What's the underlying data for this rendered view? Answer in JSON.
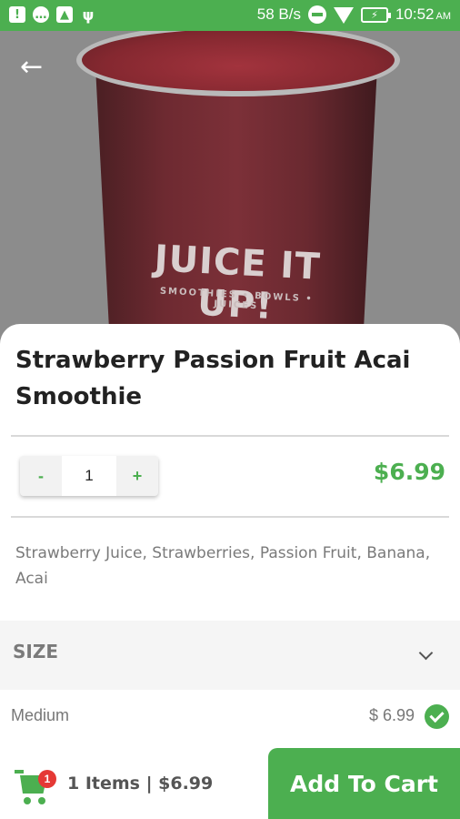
{
  "status_bar": {
    "speed": "58 B/s",
    "time": "10:52",
    "ampm": "AM",
    "icons": [
      "alert-icon",
      "message-icon",
      "image-icon",
      "usb-icon",
      "dnd-icon",
      "wifi-icon",
      "battery-charging-icon"
    ]
  },
  "hero": {
    "logo": "JUICE IT UP!",
    "logo_sub": "SMOOTHIES • BOWLS • JUICES",
    "back_icon": "arrow-left-icon"
  },
  "product": {
    "title": "Strawberry Passion Fruit Acai Smoothie",
    "price": "$6.99",
    "description": "Strawberry Juice, Strawberries, Passion Fruit, Banana, Acai"
  },
  "quantity": {
    "minus": "-",
    "value": "1",
    "plus": "+"
  },
  "size": {
    "label": "SIZE",
    "option": {
      "name": "Medium",
      "price": "$ 6.99",
      "selected": true
    }
  },
  "cart": {
    "badge": "1",
    "summary": "1 Items | $6.99",
    "add_label": "Add To Cart"
  },
  "colors": {
    "accent": "#4caf50",
    "badge": "#e53935"
  }
}
